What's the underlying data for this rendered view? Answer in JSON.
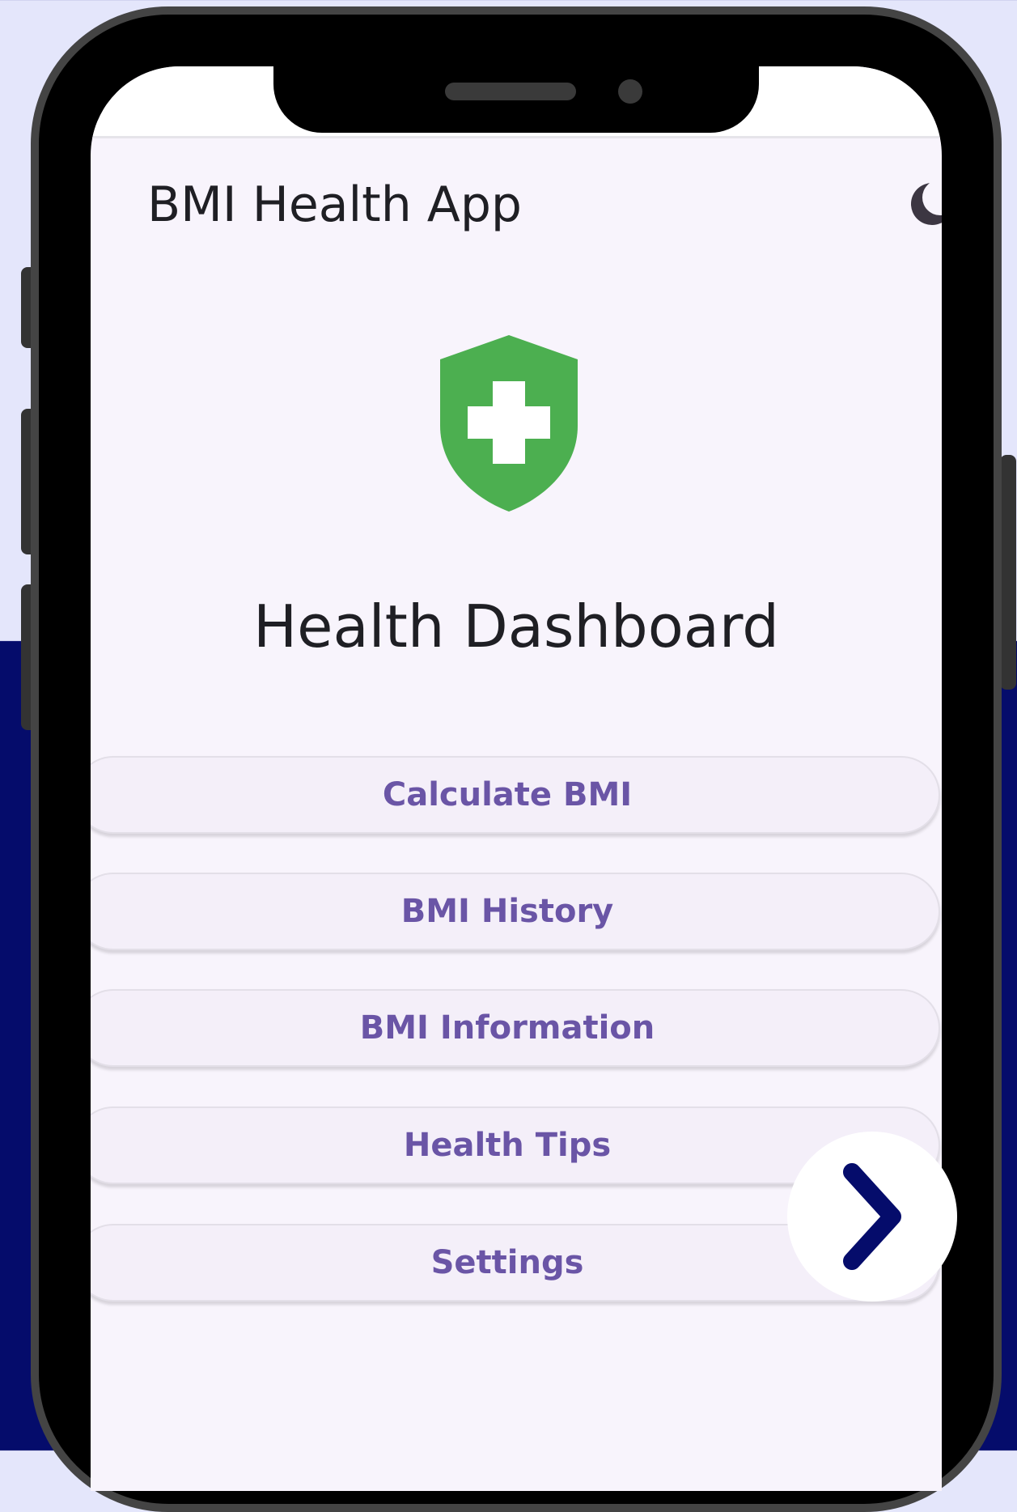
{
  "app": {
    "title": "BMI Health App"
  },
  "dashboard": {
    "title": "Health Dashboard"
  },
  "menu": [
    {
      "label": "Calculate BMI"
    },
    {
      "label": "BMI History"
    },
    {
      "label": "BMI Information"
    },
    {
      "label": "Health Tips"
    },
    {
      "label": "Settings"
    }
  ],
  "icons": {
    "theme_toggle": "moon-icon",
    "logo": "shield-plus-icon",
    "next": "chevron-right-icon"
  },
  "colors": {
    "accent_green": "#4caf50",
    "button_text": "#6a55a6",
    "navy": "#050c6b"
  }
}
